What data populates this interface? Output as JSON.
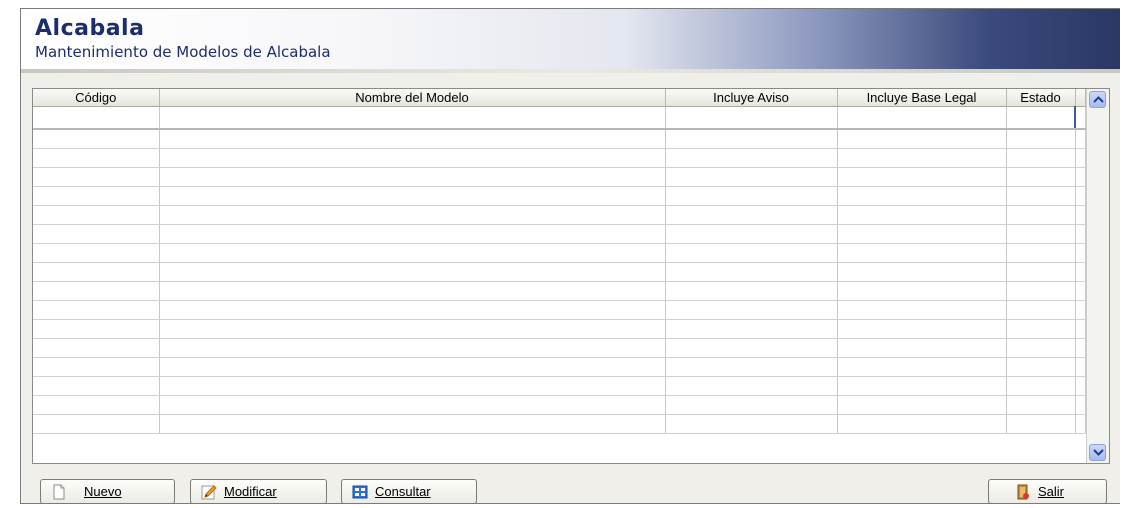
{
  "window": {
    "title": "Alcabala",
    "subtitle": "Mantenimiento de Modelos de Alcabala"
  },
  "grid": {
    "columns": [
      {
        "label": "Código"
      },
      {
        "label": "Nombre del Modelo"
      },
      {
        "label": "Incluye Aviso"
      },
      {
        "label": "Incluye Base Legal"
      },
      {
        "label": "Estado"
      }
    ],
    "rows": 17
  },
  "buttons": {
    "nuevo": "Nuevo",
    "modificar": "Modificar",
    "consultar": "Consultar",
    "salir": "Salir"
  },
  "icons": {
    "scroll_up": "chevron-up-icon",
    "scroll_down": "chevron-down-icon",
    "nuevo": "new-document-icon",
    "modificar": "pencil-icon",
    "consultar": "table-icon",
    "salir": "exit-door-icon"
  },
  "colors": {
    "header_dark": "#2b3866",
    "title_text": "#1c2d6c",
    "scroll_button": "#a7bbee"
  }
}
